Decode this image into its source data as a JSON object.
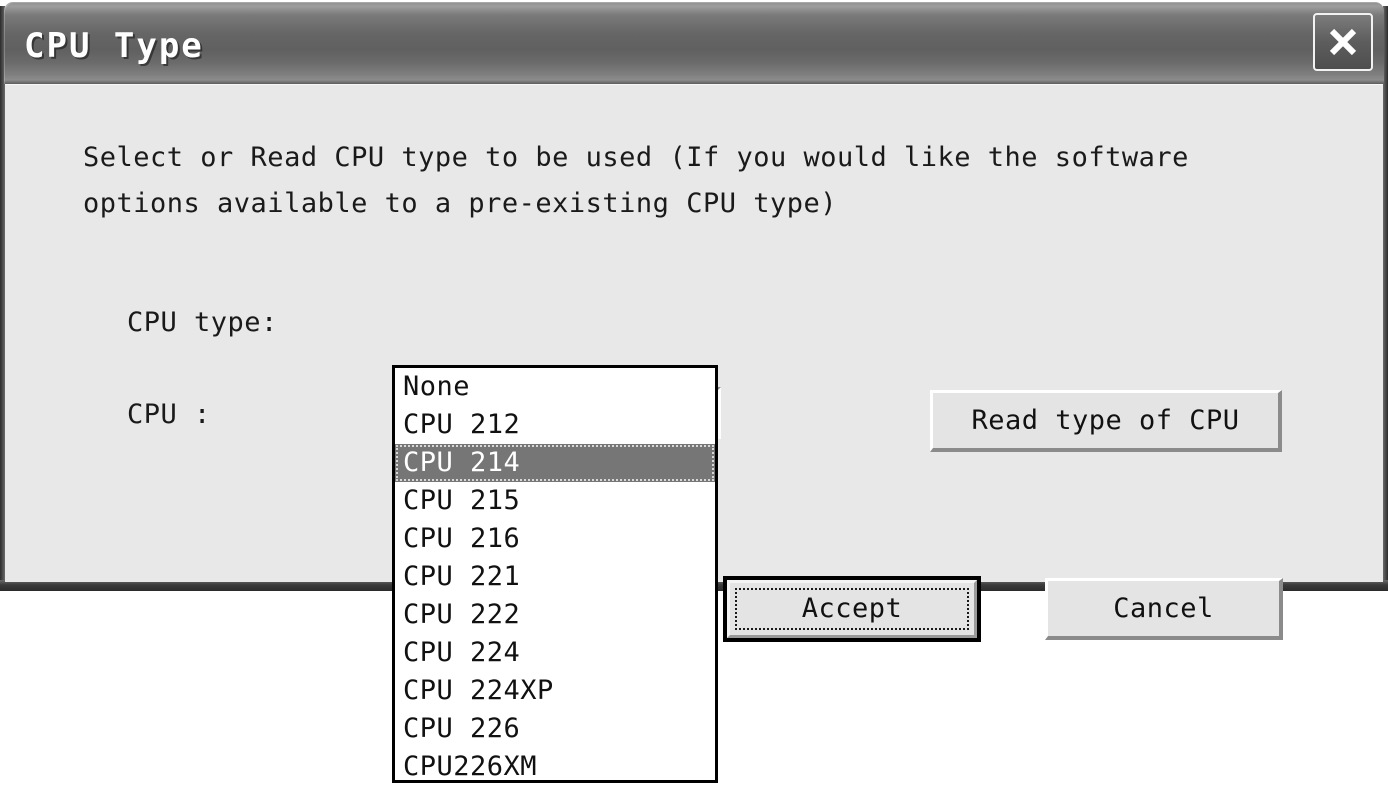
{
  "window": {
    "title": "CPU Type",
    "close_icon": "close-icon"
  },
  "instructions": {
    "line1": "Select or Read CPU type to be used (If you would like the software",
    "line2": "options available to a pre-existing CPU type)"
  },
  "fields": {
    "cpu_type_label": "CPU type:",
    "cpu_label": "CPU :"
  },
  "combobox": {
    "value": "CPU 214",
    "arrow_icon": "chevron-down-icon",
    "options": [
      "None",
      "CPU 212",
      "CPU 214",
      "CPU 215",
      "CPU 216",
      "CPU 221",
      "CPU 222",
      "CPU 224",
      "CPU 224XP",
      "CPU 226",
      "CPU226XM"
    ],
    "selected_index": 2
  },
  "buttons": {
    "read_type": "Read type of CPU",
    "accept": "Accept",
    "cancel": "Cancel"
  },
  "colors": {
    "dialog_background": "#e8e8e8",
    "titlebar_dark": "#606060",
    "titlebar_light": "#9d9d9d",
    "selection_background": "#767676",
    "selection_text": "#ffffff",
    "button_face": "#e4e4e4",
    "text": "#111111"
  }
}
